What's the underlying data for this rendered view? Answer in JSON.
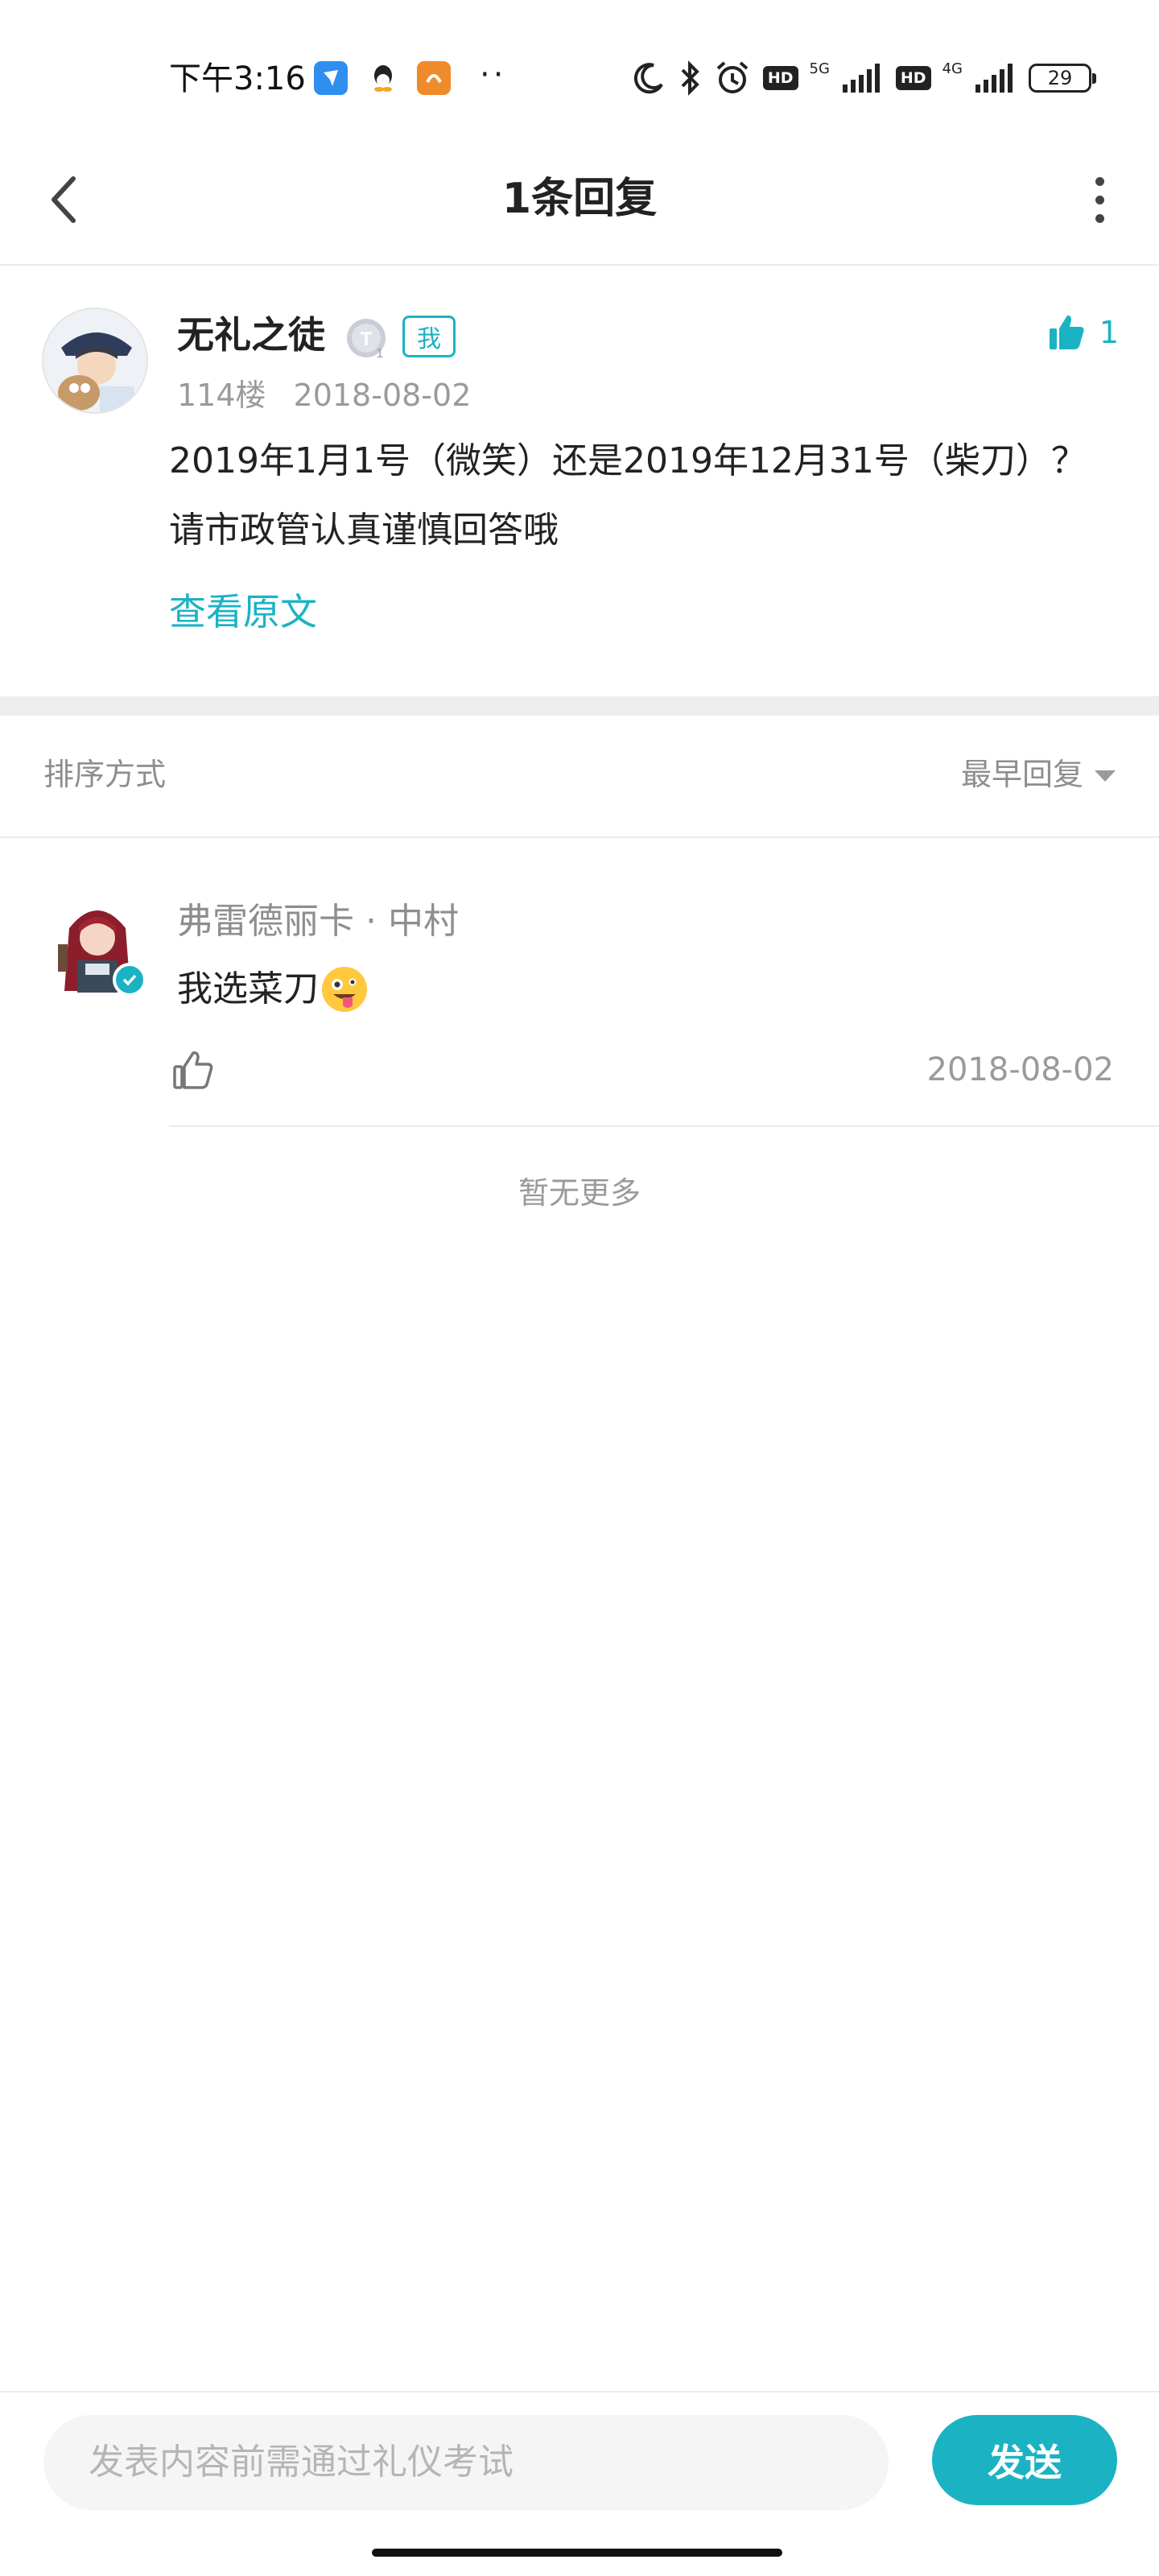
{
  "status_bar": {
    "time": "下午3:16",
    "network_1": "5G",
    "network_2": "4G",
    "hd_label": "HD",
    "battery": "29",
    "icons": [
      "moon-icon",
      "bluetooth-icon",
      "alarm-icon",
      "signal-icon"
    ]
  },
  "header": {
    "title": "1条回复"
  },
  "post": {
    "author": "无礼之徒",
    "me_badge": "我",
    "floor": "114楼",
    "date": "2018-08-02",
    "like_count": "1",
    "content": "2019年1月1号（微笑）还是2019年12月31号（柴刀）？请市政管认真谨慎回答哦",
    "view_original": "查看原文"
  },
  "sort": {
    "label": "排序方式",
    "selected": "最早回复"
  },
  "replies": [
    {
      "author": "弗雷德丽卡 · 中村",
      "text": "我选菜刀",
      "date": "2018-08-02"
    }
  ],
  "no_more": "暂无更多",
  "composer": {
    "placeholder": "发表内容前需通过礼仪考试",
    "send_label": "发送"
  },
  "colors": {
    "accent": "#1bb3c4",
    "muted_text": "#9a9a9a",
    "divider": "#eeeeee"
  }
}
